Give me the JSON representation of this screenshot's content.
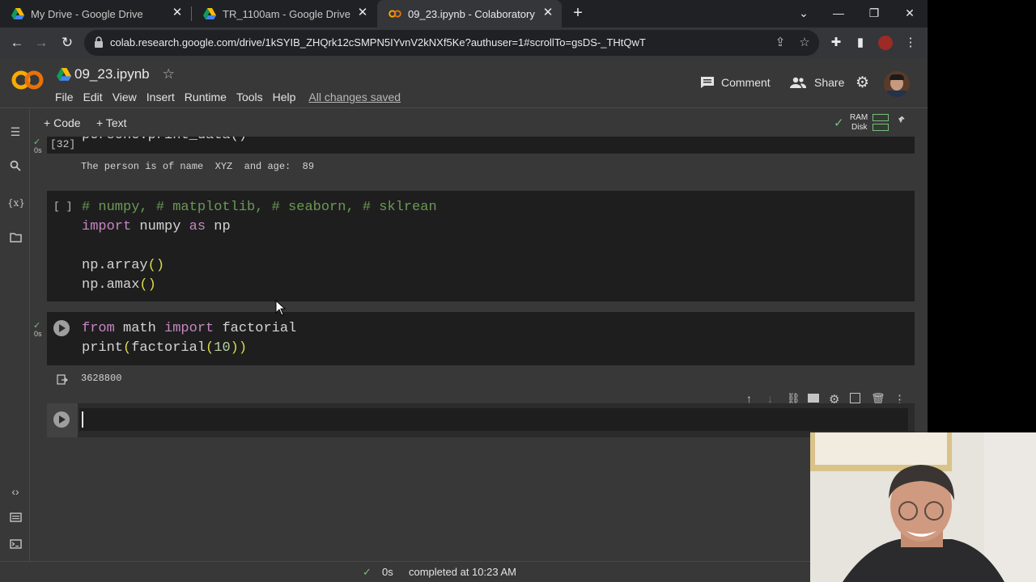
{
  "browser": {
    "tabs": [
      {
        "title": "My Drive - Google Drive"
      },
      {
        "title": "TR_1100am - Google Drive"
      },
      {
        "title": "09_23.ipynb - Colaboratory"
      }
    ],
    "url": "colab.research.google.com/drive/1kSYIB_ZHQrk12cSMPN5IYvnV2kNXf5Ke?authuser=1#scrollTo=gsDS-_THtQwT"
  },
  "colab": {
    "notebook_title": "09_23.ipynb",
    "menu": [
      "File",
      "Edit",
      "View",
      "Insert",
      "Runtime",
      "Tools",
      "Help"
    ],
    "save_status": "All changes saved",
    "comment_label": "Comment",
    "share_label": "Share",
    "add_code_label": "Code",
    "add_text_label": "Text",
    "ram_label": "RAM",
    "disk_label": "Disk"
  },
  "cells": {
    "c1": {
      "count": "[32]",
      "time": "0s",
      "code_visible": "persone.print_data()",
      "output": "The person is of name  XYZ  and age:  89"
    },
    "c2": {
      "count": "[ ]",
      "line1": "# numpy, # matplotlib, # seaborn, # sklrean",
      "line2_kw1": "import",
      "line2_mod": " numpy ",
      "line2_kw2": "as",
      "line2_alias": " np",
      "line4": "np.array",
      "line5": "np.amax"
    },
    "c3": {
      "time": "0s",
      "l1_kw1": "from",
      "l1_mod": " math ",
      "l1_kw2": "import",
      "l1_name": " factorial",
      "l2_a": "print",
      "l2_b": "factorial",
      "l2_num": "10",
      "output": "3628800"
    }
  },
  "status": {
    "time": "0s",
    "text": "completed at 10:23 AM"
  }
}
